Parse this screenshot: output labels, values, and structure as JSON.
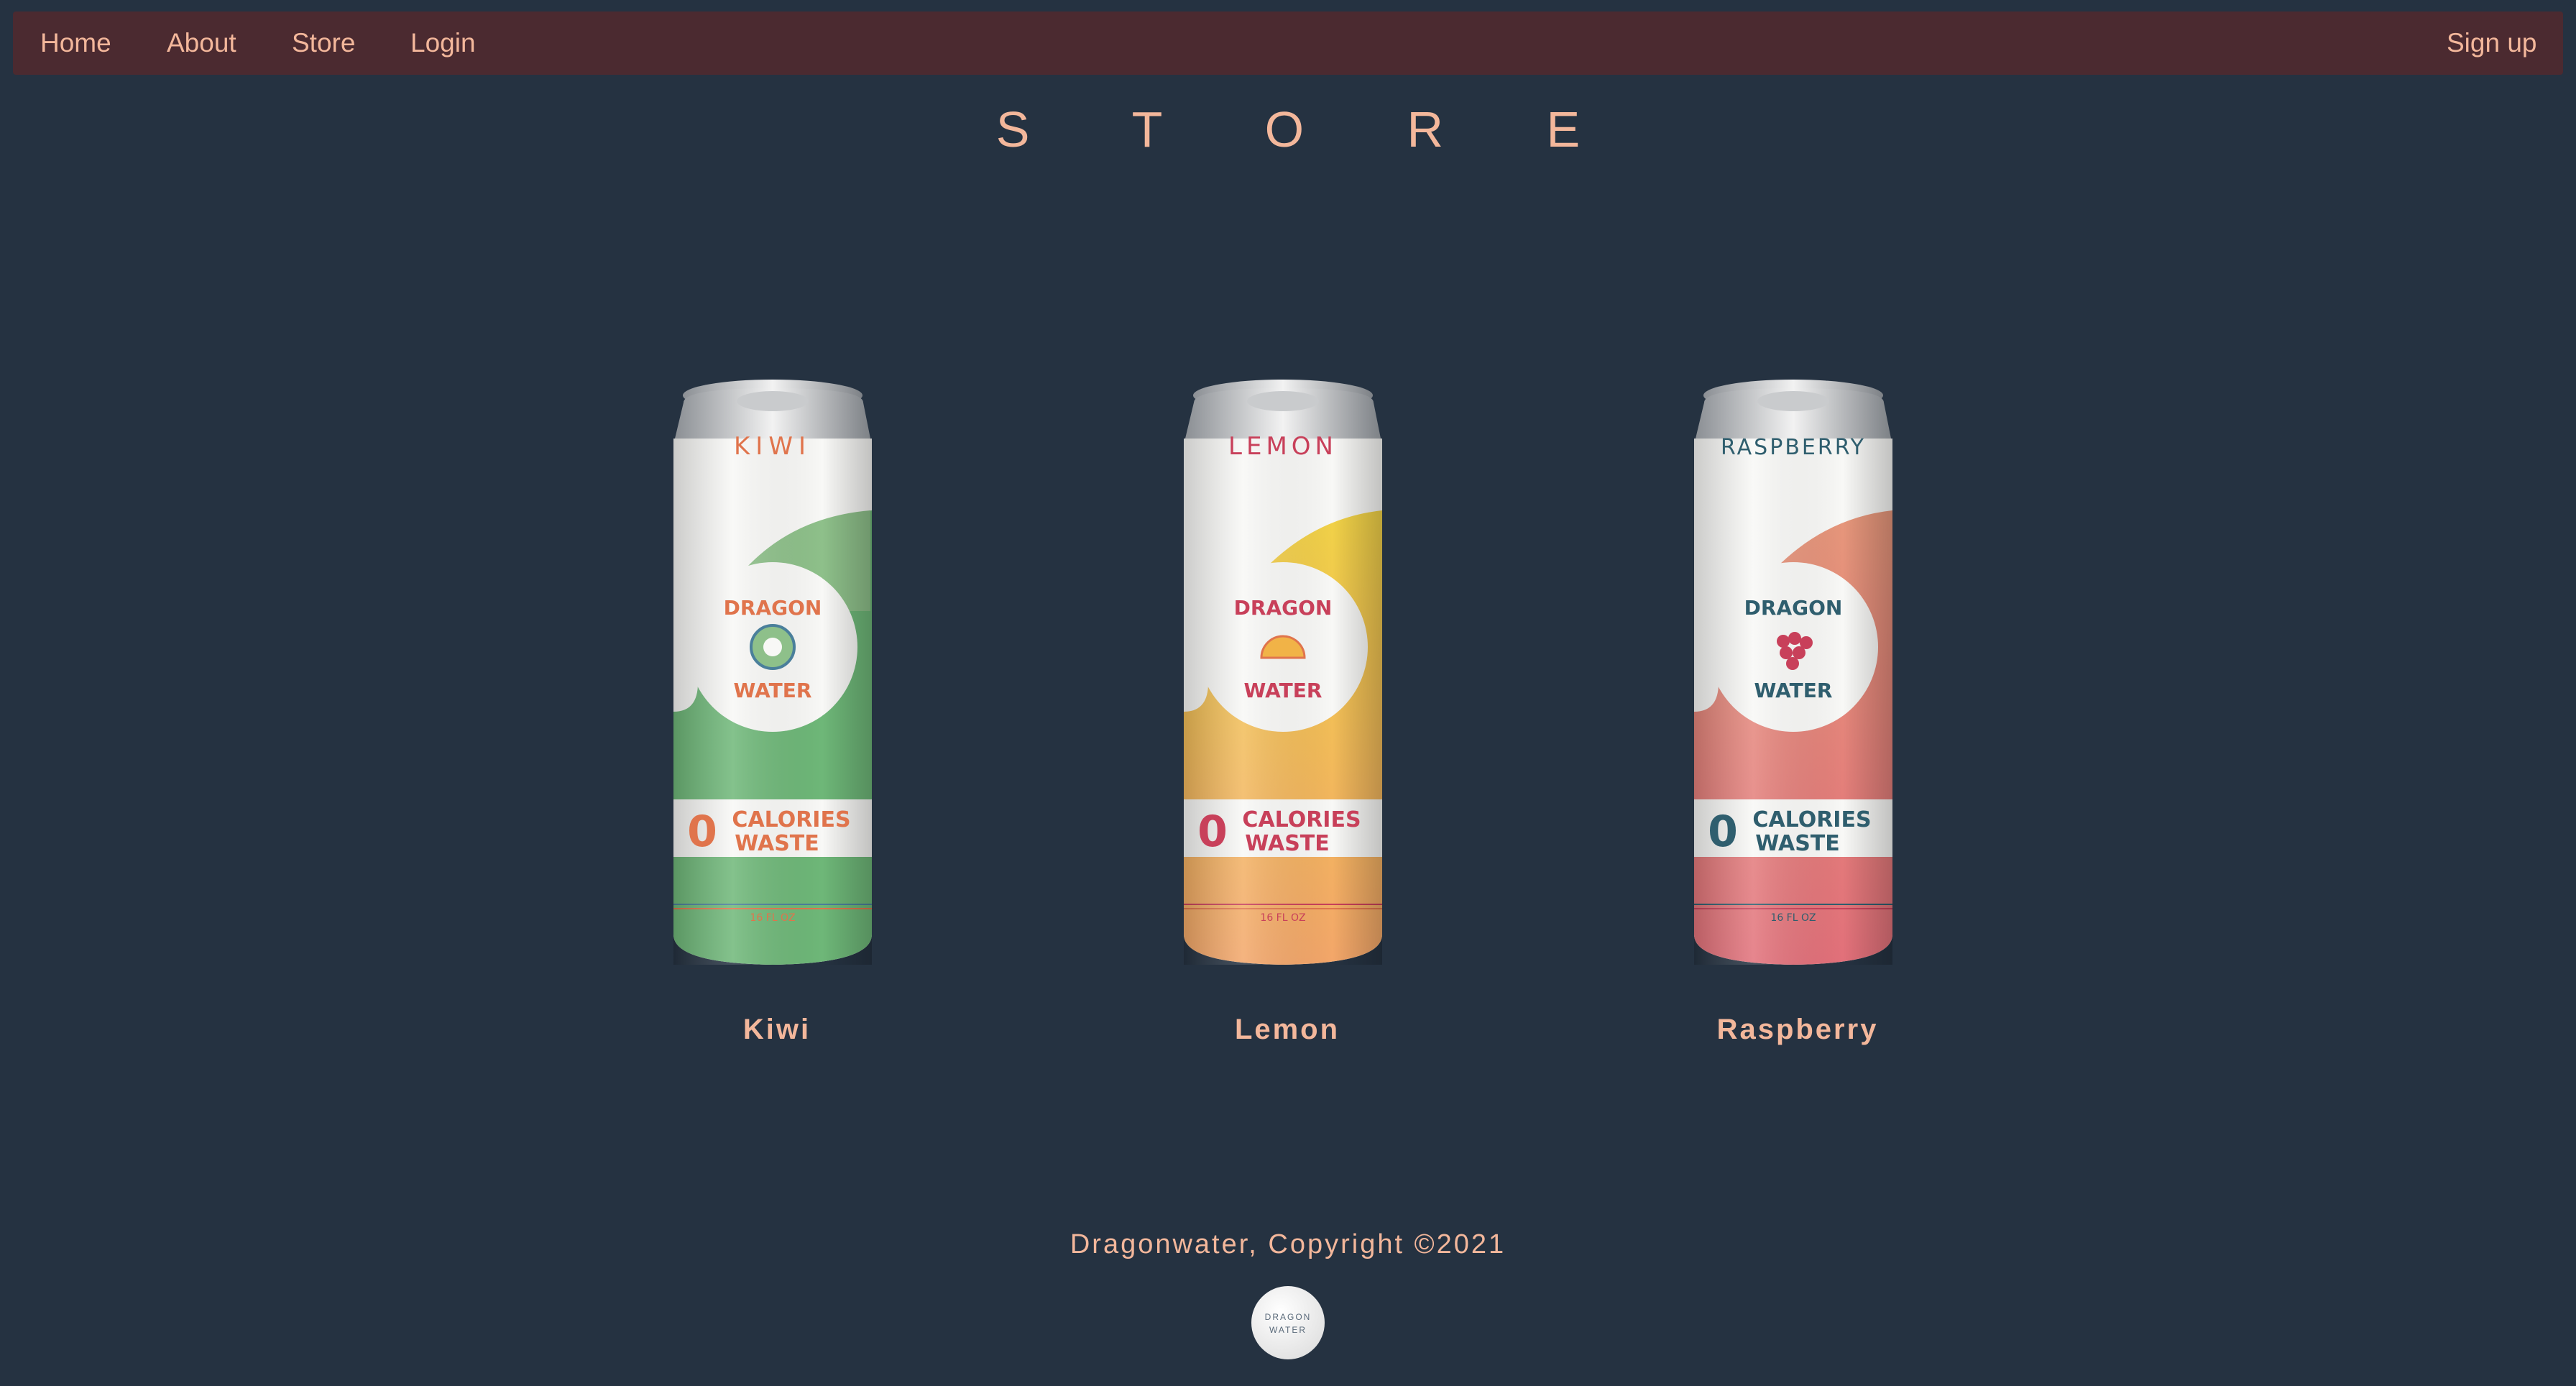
{
  "nav": {
    "home": "Home",
    "about": "About",
    "store": "Store",
    "login": "Login",
    "signup": "Sign up"
  },
  "page_title": "S T O R E",
  "products": [
    {
      "name": "Kiwi",
      "can_flavor": "KIWI",
      "can_flavor_color": "#e0744c",
      "wave_top": "#8ec08a",
      "wave_bottom": "#6eb778",
      "accent": "#e0744c"
    },
    {
      "name": "Lemon",
      "can_flavor": "LEMON",
      "can_flavor_color": "#c8405a",
      "wave_top": "#f1d247",
      "wave_bottom": "#f1b35b",
      "accent": "#c8405a"
    },
    {
      "name": "Raspberry",
      "can_flavor": "RASPBERRY",
      "can_flavor_color": "#2f5e6e",
      "wave_top": "#e6977b",
      "wave_bottom": "#e2707a",
      "accent": "#2f5e6e"
    }
  ],
  "can_text": {
    "brand_line1": "DRAGON",
    "brand_line2": "WATER",
    "zero": "0",
    "calories": "CALORIES",
    "waste": "WASTE",
    "volume": "16 FL OZ"
  },
  "footer": {
    "copyright": "Dragonwater, Copyright ©2021",
    "logo_line1": "DRAGON",
    "logo_line2": "WATER"
  },
  "colors": {
    "background": "#253241",
    "navbar": "#4b2a30",
    "accent_text": "#f3b79b"
  }
}
